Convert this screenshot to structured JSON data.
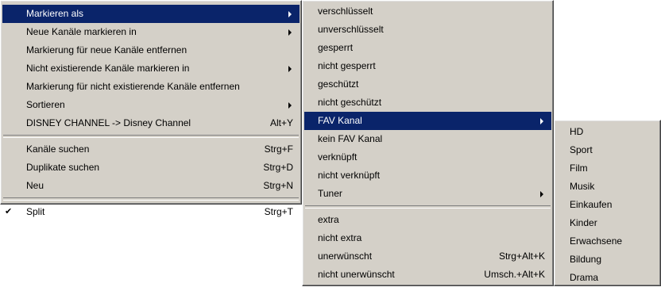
{
  "main_menu": {
    "items": [
      {
        "label": "Markieren als",
        "shortcut": "",
        "submenu": true,
        "selected": true
      },
      {
        "label": "Neue Kanäle markieren in",
        "shortcut": "",
        "submenu": true
      },
      {
        "label": "Markierung für neue Kanäle entfernen",
        "shortcut": ""
      },
      {
        "label": "Nicht existierende Kanäle markieren in",
        "shortcut": "",
        "submenu": true
      },
      {
        "label": "Markierung für nicht existierende Kanäle entfernen",
        "shortcut": ""
      },
      {
        "label": "Sortieren",
        "shortcut": "",
        "submenu": true
      },
      {
        "label": "DISNEY CHANNEL -> Disney Channel",
        "shortcut": "Alt+Y"
      },
      {
        "label": "Kanäle suchen",
        "shortcut": "Strg+F"
      },
      {
        "label": "Duplikate suchen",
        "shortcut": "Strg+D"
      },
      {
        "label": "Neu",
        "shortcut": "Strg+N"
      },
      {
        "label": "Split",
        "shortcut": "Strg+T",
        "checked": true
      }
    ],
    "check_mark": "✔"
  },
  "mark_as_menu": {
    "items": [
      {
        "label": "verschlüsselt"
      },
      {
        "label": "unverschlüsselt"
      },
      {
        "label": "gesperrt"
      },
      {
        "label": "nicht gesperrt"
      },
      {
        "label": "geschützt"
      },
      {
        "label": "nicht geschützt"
      },
      {
        "label": "FAV Kanal",
        "submenu": true,
        "selected": true
      },
      {
        "label": "kein FAV Kanal"
      },
      {
        "label": "verknüpft"
      },
      {
        "label": "nicht verknüpft"
      },
      {
        "label": "Tuner",
        "submenu": true
      },
      {
        "label": "extra"
      },
      {
        "label": "nicht extra"
      },
      {
        "label": "unerwünscht",
        "shortcut": "Strg+Alt+K"
      },
      {
        "label": "nicht unerwünscht",
        "shortcut": "Umsch.+Alt+K"
      }
    ]
  },
  "fav_menu": {
    "items": [
      {
        "label": "HD"
      },
      {
        "label": "Sport"
      },
      {
        "label": "Film"
      },
      {
        "label": "Musik"
      },
      {
        "label": "Einkaufen"
      },
      {
        "label": "Kinder"
      },
      {
        "label": "Erwachsene"
      },
      {
        "label": "Bildung"
      },
      {
        "label": "Drama"
      }
    ]
  },
  "colors": {
    "menu_bg": "#d4d0c8",
    "selection_bg": "#0a246a",
    "selection_fg": "#ffffff"
  }
}
